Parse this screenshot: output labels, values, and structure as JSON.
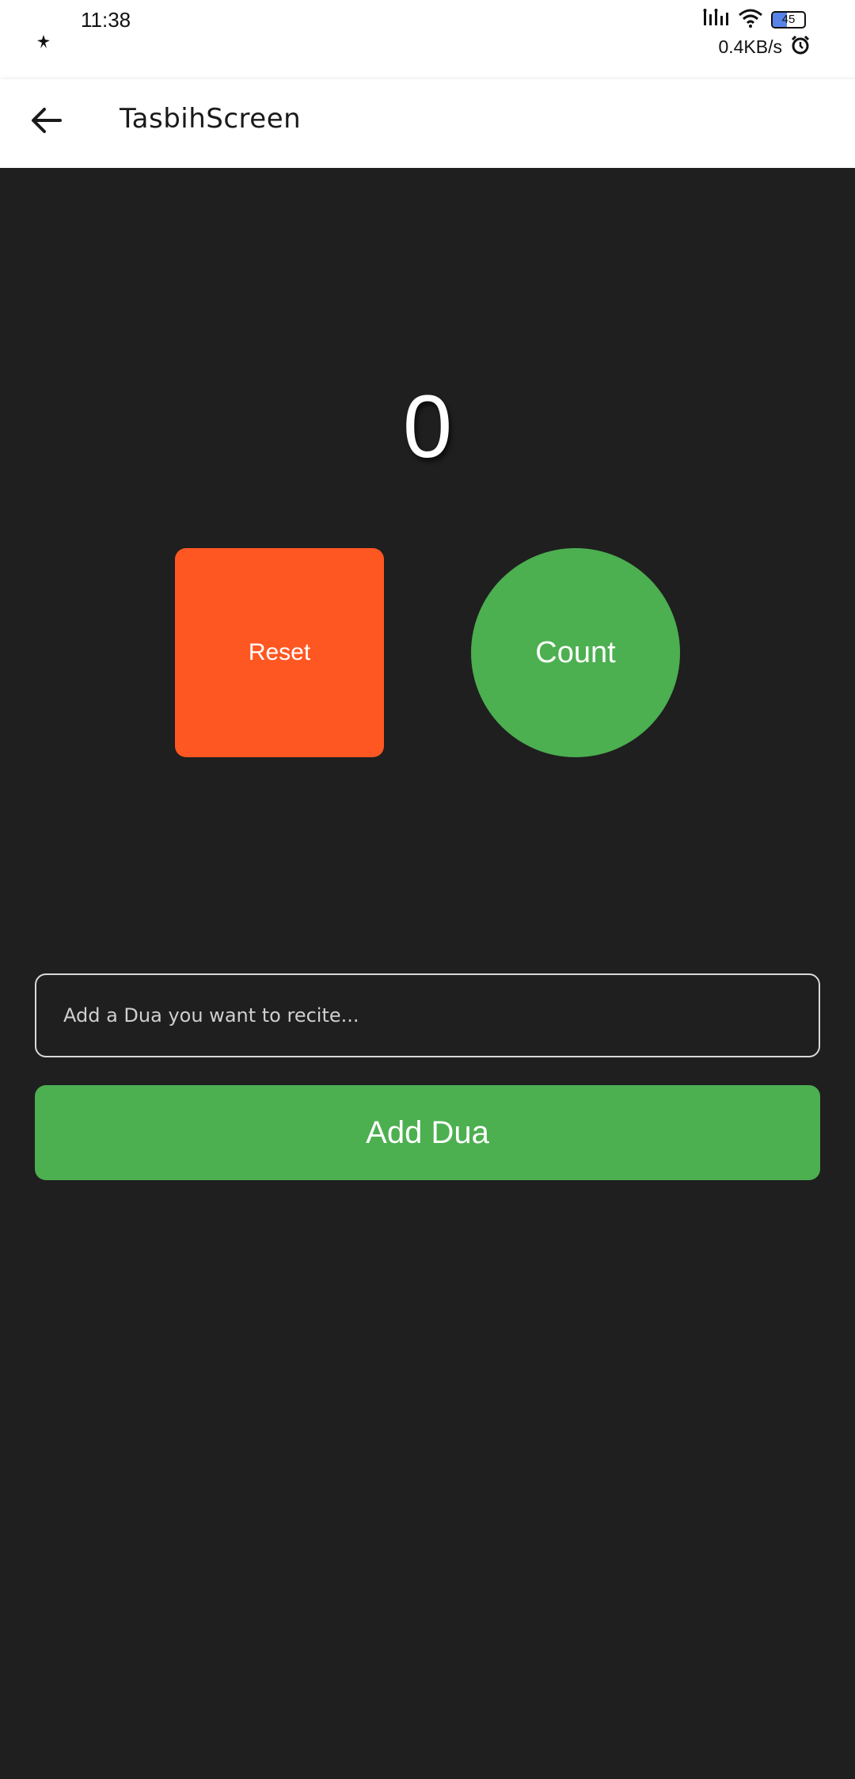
{
  "status_bar": {
    "time": "11:38",
    "network_speed": "0.4KB/s",
    "battery_level": "45",
    "icons": [
      "notification-icon",
      "signal-icon",
      "wifi-icon",
      "battery-icon",
      "alarm-icon"
    ]
  },
  "app_bar": {
    "title": "TasbihScreen",
    "back_icon": "arrow-left-icon"
  },
  "counter": {
    "value": "0"
  },
  "buttons": {
    "reset_label": "Reset",
    "count_label": "Count",
    "add_dua_label": "Add Dua"
  },
  "dua_input": {
    "placeholder": "Add a Dua you want to recite...",
    "value": ""
  },
  "colors": {
    "background": "#1f1f1f",
    "reset": "#ff5722",
    "accent_green": "#4caf50",
    "app_bar": "#ffffff"
  }
}
